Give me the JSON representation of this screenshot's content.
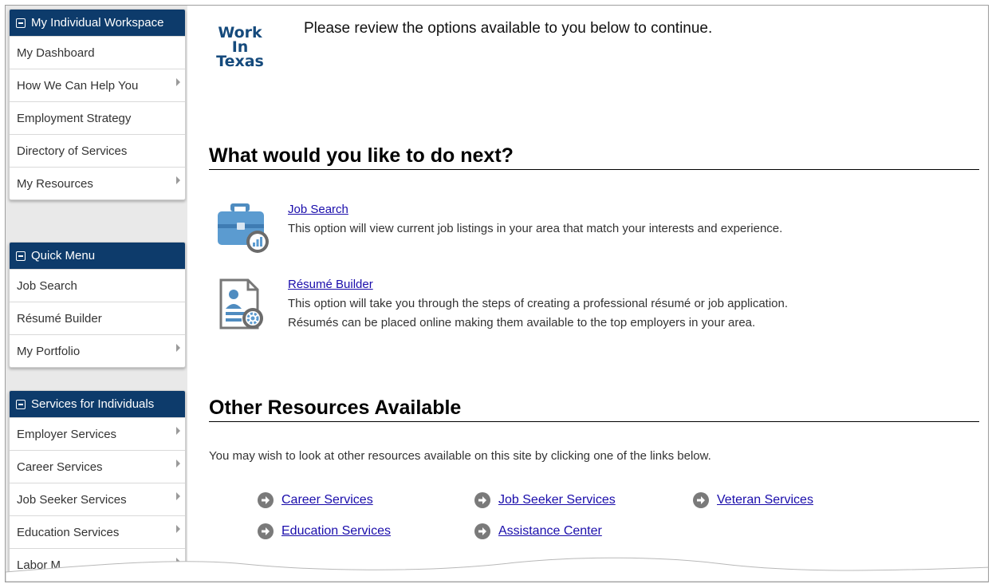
{
  "sidebar": {
    "workspace": {
      "title": "My Individual Workspace",
      "items": [
        {
          "label": "My Dashboard",
          "submenu": false
        },
        {
          "label": "How We Can Help You",
          "submenu": true
        },
        {
          "label": "Employment Strategy",
          "submenu": false
        },
        {
          "label": "Directory of Services",
          "submenu": false
        },
        {
          "label": "My Resources",
          "submenu": true
        }
      ]
    },
    "quick_menu": {
      "title": "Quick Menu",
      "items": [
        {
          "label": "Job Search",
          "submenu": false
        },
        {
          "label": "Résumé Builder",
          "submenu": false
        },
        {
          "label": "My Portfolio",
          "submenu": true
        }
      ]
    },
    "services": {
      "title": "Services for Individuals",
      "items": [
        {
          "label": "Employer Services",
          "submenu": true
        },
        {
          "label": "Career Services",
          "submenu": true
        },
        {
          "label": "Job Seeker Services",
          "submenu": true
        },
        {
          "label": "Education Services",
          "submenu": true
        },
        {
          "label": "Labor M",
          "submenu": true
        }
      ]
    }
  },
  "main": {
    "logo": {
      "line1": "Work",
      "line2": "In",
      "line3": "Texas"
    },
    "intro": "Please review the options available to you below to continue.",
    "next_heading": "What would you like to do next?",
    "options": {
      "job_search": {
        "title": "Job Search",
        "desc": "This option will view current job listings in your area that match your interests and experience.",
        "icon": "briefcase-chart-icon"
      },
      "resume_builder": {
        "title": "Résumé Builder",
        "desc1": "This option will take you through the steps of creating a professional résumé or job application.",
        "desc2": "Résumés can be placed online making them available to the top employers in your area.",
        "icon": "resume-gear-icon"
      }
    },
    "other_heading": "Other Resources Available",
    "other_note": "You may wish to look at other resources available on this site by clicking one of the links below.",
    "resource_links": {
      "career": "Career Services",
      "job_seeker": "Job Seeker Services",
      "veteran": "Veteran Services",
      "education": "Education Services",
      "assistance": "Assistance Center"
    }
  },
  "colors": {
    "panel_header": "#0d3b6b",
    "link": "#1a0dab",
    "logo": "#154a7c",
    "sidebar_bg": "#e9e9e9"
  }
}
